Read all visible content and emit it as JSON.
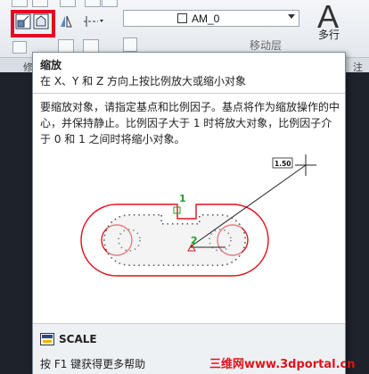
{
  "ribbon": {
    "layer_combo_value": "AM_0",
    "text_big_glyph": "A",
    "text_multiline_label": "多行",
    "obscured_item_label": "移动层",
    "panel_label_left": "修",
    "panel_label_right": "注"
  },
  "tooltip": {
    "title": "缩放",
    "short_desc": "在 X、Y 和 Z 方向上按比例放大或缩小对象",
    "long_desc": "要缩放对象，请指定基点和比例因子。基点将作为缩放操作的中心，并保持静止。比例因子大于 1 时将放大对象，比例因子介于 0 和 1 之间时将缩小对象。",
    "illustration": {
      "scale_label": "1.50",
      "marker_1": "1",
      "marker_2": "2"
    },
    "command_name": "SCALE",
    "help_text": "按 F1 键获得更多帮助"
  },
  "watermark": "三维网www.3dportal.cn",
  "colors": {
    "highlight_red": "#e4081d",
    "shape_red": "#e0101a",
    "marker_green": "#22a022",
    "watermark_red": "#e1121a"
  },
  "icons": [
    "scale-icon",
    "stretch-icon",
    "lightbulb-icon",
    "sun-icon",
    "unlock-icon",
    "mirror-icon",
    "array-icon",
    "command-scale-icon"
  ]
}
